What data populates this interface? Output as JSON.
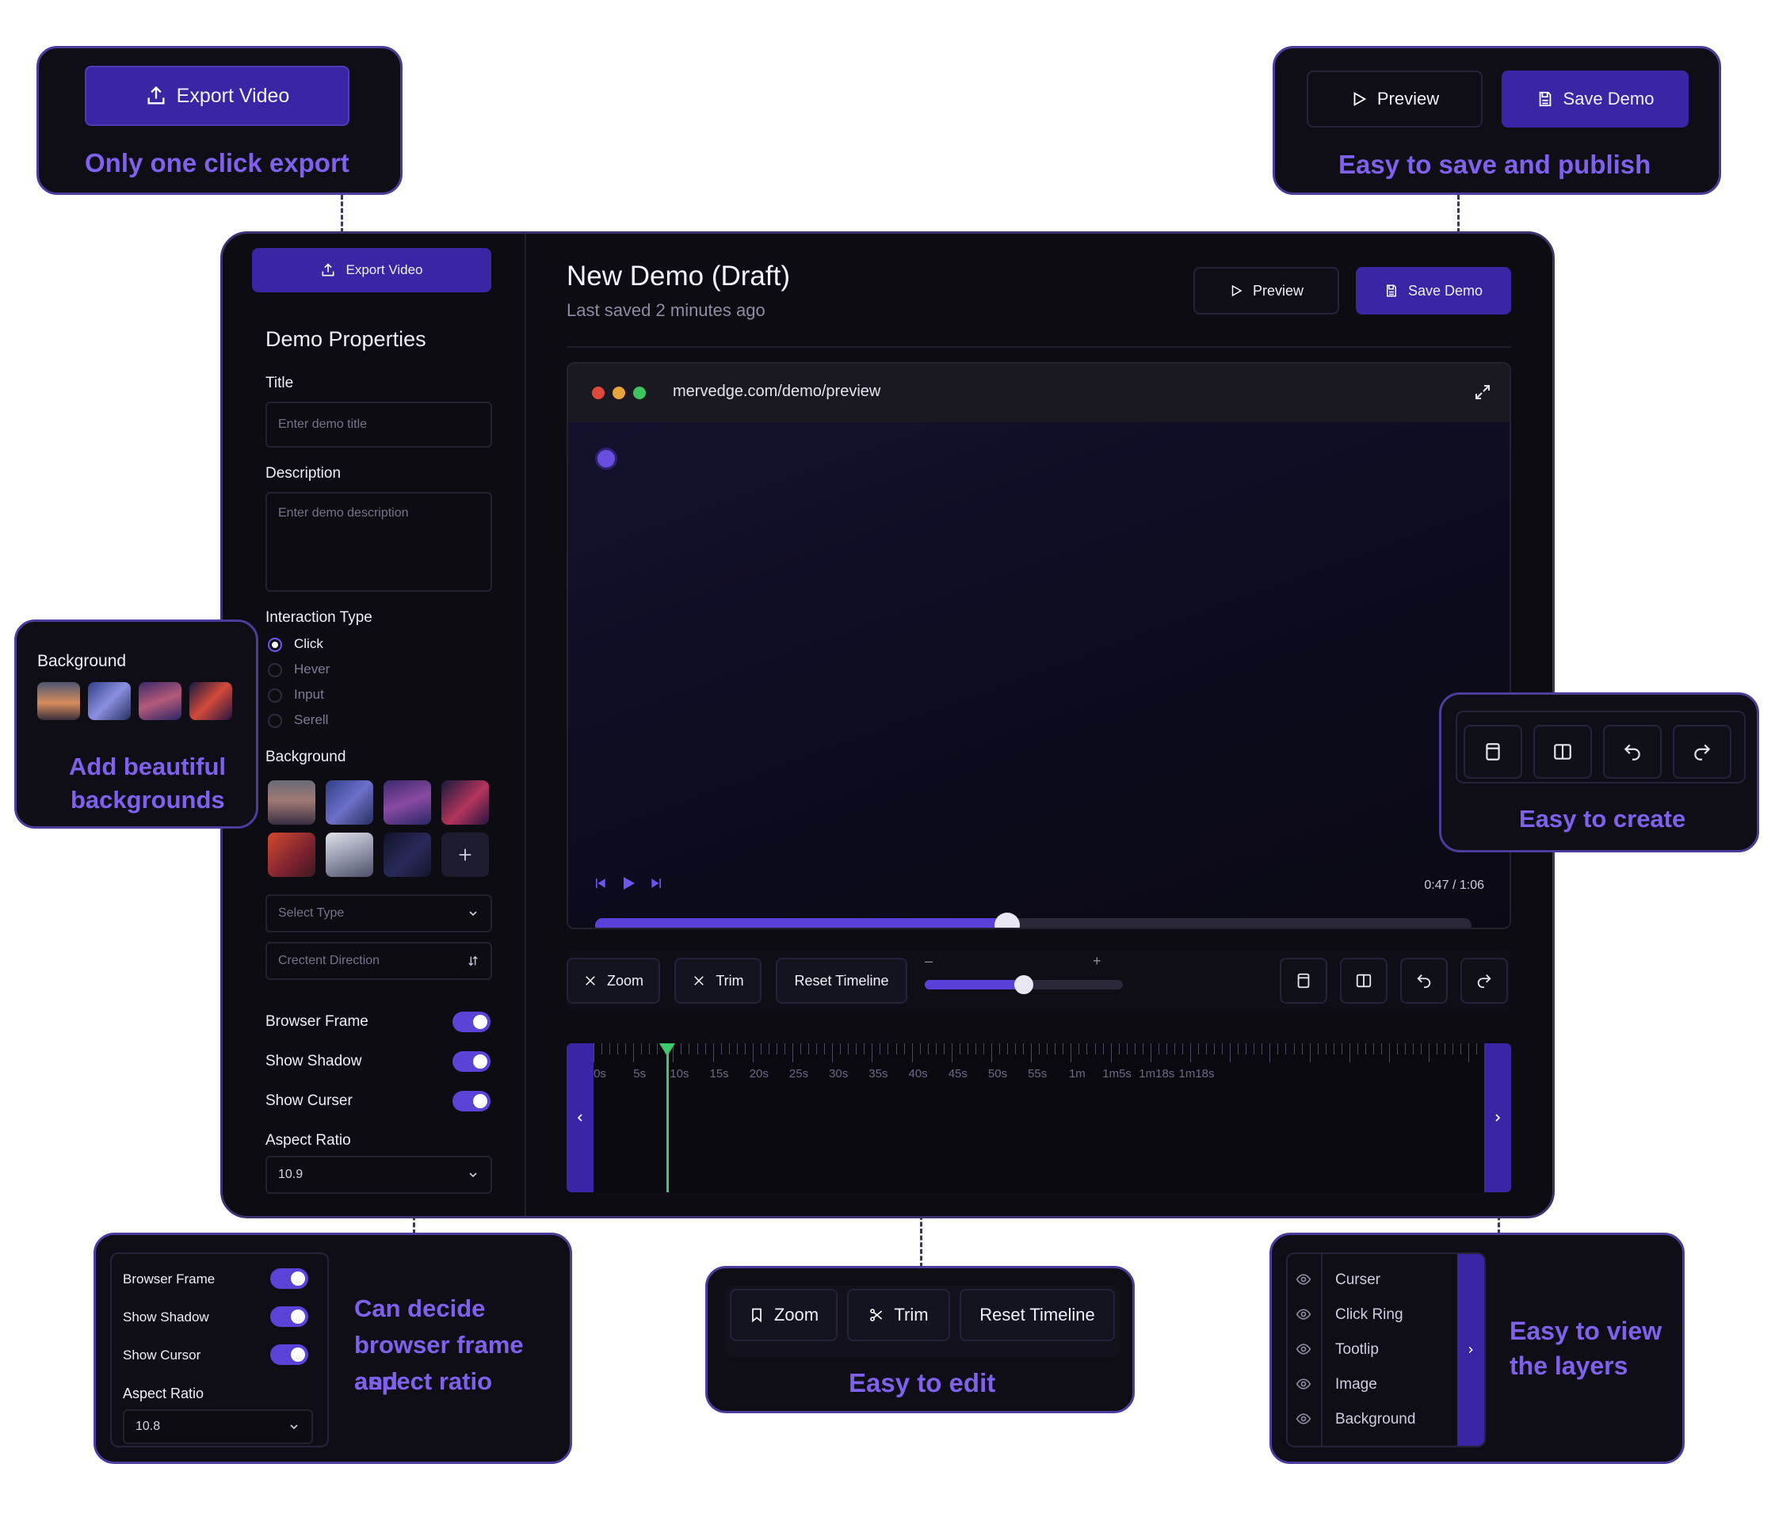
{
  "callouts": {
    "export": {
      "button_label": "Export Video",
      "caption": "Only one click export"
    },
    "save": {
      "preview_label": "Preview",
      "save_label": "Save Demo",
      "caption": "Easy to save and publish"
    },
    "background": {
      "title": "Background",
      "caption_line1": "Add beautiful",
      "caption_line2": "backgrounds"
    },
    "create": {
      "caption": "Easy to create"
    },
    "frame": {
      "toggles": [
        "Browser Frame",
        "Show Shadow",
        "Show Cursor"
      ],
      "aspect_label": "Aspect Ratio",
      "aspect_value": "10.8",
      "caption_line1": "Can decide",
      "caption_line2": "browser frame and",
      "caption_line3": "aspect ratio"
    },
    "edit": {
      "zoom": "Zoom",
      "trim": "Trim",
      "reset": "Reset Timeline",
      "caption": "Easy to edit"
    },
    "layers": {
      "items": [
        "Curser",
        "Click Ring",
        "Tootlip",
        "Image",
        "Background"
      ],
      "caption_line1": "Easy to view",
      "caption_line2": "the layers"
    }
  },
  "app": {
    "sidebar": {
      "export_label": "Export Video",
      "section_title": "Demo Properties",
      "title_label": "Title",
      "title_placeholder": "Enter demo title",
      "description_label": "Description",
      "description_placeholder": "Enter demo description",
      "interaction_label": "Interaction Type",
      "interaction_options": [
        "Click",
        "Hever",
        "Input",
        "Serell"
      ],
      "interaction_selected": "Click",
      "background_label": "Background",
      "select_type": "Select Type",
      "gradient_direction": "Crectent Direction",
      "toggles": [
        "Browser Frame",
        "Show Shadow",
        "Show Curser"
      ],
      "aspect_label": "Aspect Ratio",
      "aspect_value": "10.9"
    },
    "header": {
      "title": "New Demo (Draft)",
      "subtitle": "Last saved 2 minutes ago",
      "preview_label": "Preview",
      "save_label": "Save Demo"
    },
    "preview": {
      "url": "mervedge.com/demo/preview",
      "time": "0:47 / 1:06",
      "progress": 0.47
    },
    "toolbar": {
      "zoom": "Zoom",
      "trim": "Trim",
      "reset": "Reset Timeline",
      "minus": "–",
      "plus": "+",
      "zoom_level": 0.5
    },
    "timeline": {
      "labels": [
        "0s",
        "5s",
        "10s",
        "15s",
        "20s",
        "25s",
        "30s",
        "35s",
        "40s",
        "45s",
        "50s",
        "55s",
        "1m",
        "1m5s",
        "1m18s",
        "1m18s"
      ],
      "playhead_label": "6s"
    }
  },
  "colors": {
    "accent": "#3a25a5",
    "accent_text": "#7f61ee",
    "playhead": "#3ec96a"
  }
}
